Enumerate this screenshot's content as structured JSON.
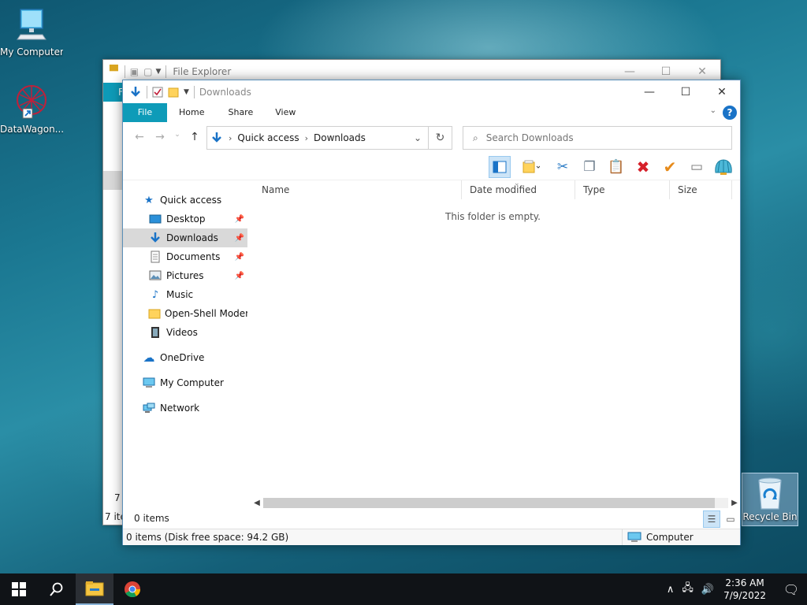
{
  "desktop": {
    "icons": [
      {
        "name": "my-computer",
        "label": "My Computer"
      },
      {
        "name": "datawagon",
        "label": "DataWagon..."
      }
    ],
    "recycle_bin_label": "Recycle Bin"
  },
  "back_window": {
    "title": "File Explorer",
    "ribbon_tab": "F",
    "status_items": "7 i",
    "status_items2": "7 ite"
  },
  "window": {
    "title": "Downloads",
    "tabs": [
      "File",
      "Home",
      "Share",
      "View"
    ],
    "breadcrumb": [
      "Quick access",
      "Downloads"
    ],
    "search_placeholder": "Search Downloads",
    "columns": [
      "Name",
      "Date modified",
      "Type",
      "Size"
    ],
    "empty_message": "This folder is empty.",
    "items_count": "0 items",
    "status_left": "0 items (Disk free space: 94.2 GB)",
    "status_right": "Computer"
  },
  "nav_pane": {
    "quick_access": "Quick access",
    "pinned": [
      {
        "label": "Desktop",
        "icon": "desktop-icon",
        "pinned": true
      },
      {
        "label": "Downloads",
        "icon": "download-icon",
        "pinned": true,
        "selected": true
      },
      {
        "label": "Documents",
        "icon": "document-icon",
        "pinned": true
      },
      {
        "label": "Pictures",
        "icon": "pictures-icon",
        "pinned": true
      },
      {
        "label": "Music",
        "icon": "music-icon",
        "pinned": false
      },
      {
        "label": "Open-Shell Modern",
        "icon": "folder-icon",
        "pinned": false
      },
      {
        "label": "Videos",
        "icon": "videos-icon",
        "pinned": false
      }
    ],
    "onedrive": "OneDrive",
    "my_computer": "My Computer",
    "network": "Network"
  },
  "taskbar": {
    "time": "2:36 AM",
    "date": "7/9/2022"
  },
  "colors": {
    "accent": "#0e9bb8",
    "selection": "#cce4f7",
    "taskbar": "#101317"
  }
}
